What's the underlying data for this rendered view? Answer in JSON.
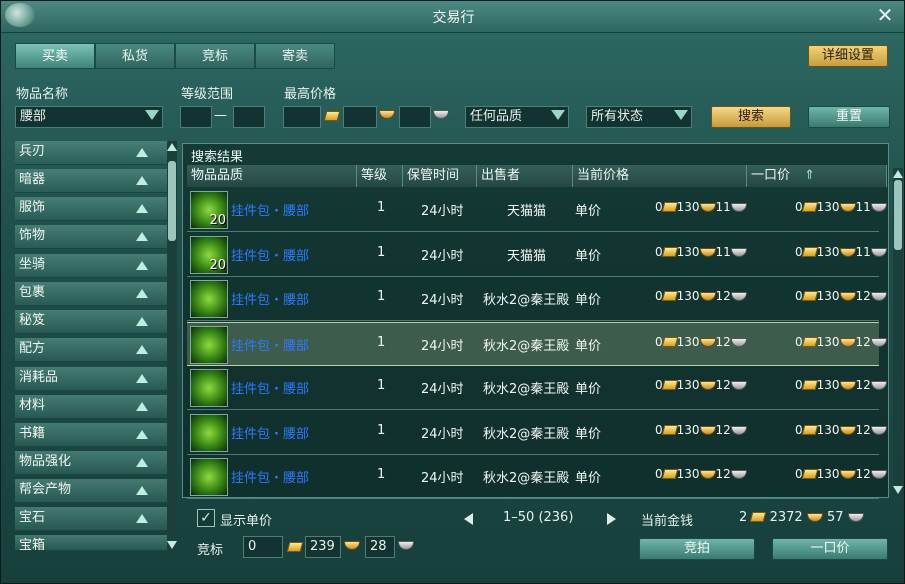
{
  "window": {
    "title": "交易行"
  },
  "tabs": [
    {
      "label": "买卖"
    },
    {
      "label": "私货"
    },
    {
      "label": "竞标"
    },
    {
      "label": "寄卖"
    }
  ],
  "detail_settings_label": "详细设置",
  "filters": {
    "item_name_label": "物品名称",
    "item_name_value": "腰部",
    "level_range_label": "等级范围",
    "level_dash": "—",
    "max_price_label": "最高价格",
    "quality_value": "任何品质",
    "status_value": "所有状态",
    "search_label": "搜索",
    "reset_label": "重置"
  },
  "categories": [
    "兵刃",
    "暗器",
    "服饰",
    "饰物",
    "坐骑",
    "包裹",
    "秘笈",
    "配方",
    "消耗品",
    "材料",
    "书籍",
    "物品强化",
    "帮会产物",
    "宝石",
    "宝箱"
  ],
  "results": {
    "title": "搜索结果",
    "columns": [
      "物品品质",
      "等级",
      "保管时间",
      "出售者",
      "当前价格",
      "一口价"
    ],
    "rows": [
      {
        "count": "20",
        "name": "挂件包・腰部",
        "level": "1",
        "time": "24小时",
        "seller": "天猫猫",
        "current": "单价",
        "p_gold": "0",
        "p_silver": "130",
        "p_copper": "11"
      },
      {
        "count": "20",
        "name": "挂件包・腰部",
        "level": "1",
        "time": "24小时",
        "seller": "天猫猫",
        "current": "单价",
        "p_gold": "0",
        "p_silver": "130",
        "p_copper": "11"
      },
      {
        "count": "",
        "name": "挂件包・腰部",
        "level": "1",
        "time": "24小时",
        "seller": "秋水2@秦王殿",
        "current": "单价",
        "p_gold": "0",
        "p_silver": "130",
        "p_copper": "12"
      },
      {
        "count": "",
        "name": "挂件包・腰部",
        "level": "1",
        "time": "24小时",
        "seller": "秋水2@秦王殿",
        "current": "单价",
        "p_gold": "0",
        "p_silver": "130",
        "p_copper": "12"
      },
      {
        "count": "",
        "name": "挂件包・腰部",
        "level": "1",
        "time": "24小时",
        "seller": "秋水2@秦王殿",
        "current": "单价",
        "p_gold": "0",
        "p_silver": "130",
        "p_copper": "12"
      },
      {
        "count": "",
        "name": "挂件包・腰部",
        "level": "1",
        "time": "24小时",
        "seller": "秋水2@秦王殿",
        "current": "单价",
        "p_gold": "0",
        "p_silver": "130",
        "p_copper": "12"
      },
      {
        "count": "",
        "name": "挂件包・腰部",
        "level": "1",
        "time": "24小时",
        "seller": "秋水2@秦王殿",
        "current": "单价",
        "p_gold": "0",
        "p_silver": "130",
        "p_copper": "12"
      }
    ]
  },
  "bottom": {
    "show_unit_price_label": "显示单价",
    "show_unit_price_checked": "✓",
    "page_info": "1–50 (236)",
    "current_money_label": "当前金钱",
    "money_gold": "2",
    "money_silver": "2372",
    "money_copper": "57",
    "bid_label": "竞标",
    "bid_gold": "0",
    "bid_silver": "239",
    "bid_copper": "28",
    "bid_button": "竞拍",
    "buyout_button": "一口价"
  },
  "colors": {
    "accent_gold": "#c79e3b",
    "item_name": "#2b7bff",
    "panel": "#1f4f4b"
  },
  "icons": [
    "close-icon",
    "dropdown-arrow-icon",
    "gold-bar-icon",
    "gold-ingot-icon",
    "silver-ingot-icon",
    "sort-up-icon",
    "item-bag-icon"
  ]
}
